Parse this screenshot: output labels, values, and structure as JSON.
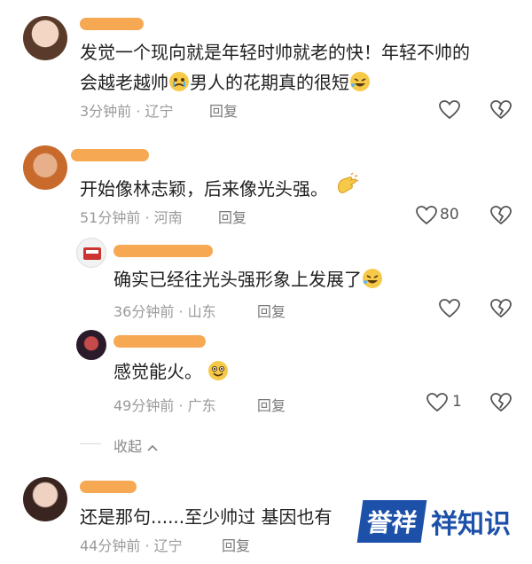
{
  "comments": [
    {
      "text_line1": "发觉一个现向就是年轻时帅就老的快！年轻不帅的",
      "text_line2": "会越老越帅",
      "text_line2_tail": "男人的花期真的很短",
      "time": "3分钟前 · 辽宁",
      "reply": "回复"
    },
    {
      "text": "开始像林志颖，后来像光头强。",
      "time": "51分钟前 · 河南",
      "reply": "回复",
      "likes": "80"
    },
    {
      "text": "确实已经往光头强形象上发展了",
      "time": "36分钟前 · 山东",
      "reply": "回复"
    },
    {
      "text": "感觉能火。",
      "time": "49分钟前 · 广东",
      "reply": "回复",
      "likes": "1"
    },
    {
      "text": "还是那句......至少帅过 基因也有",
      "time": "44分钟前 · 辽宁",
      "reply": "回复"
    }
  ],
  "collapse_label": "收起",
  "watermark": {
    "block": "誉祥",
    "text": "祥知识"
  },
  "colors": {
    "redact": "#f5a34a",
    "watermark": "#1d50a8"
  }
}
